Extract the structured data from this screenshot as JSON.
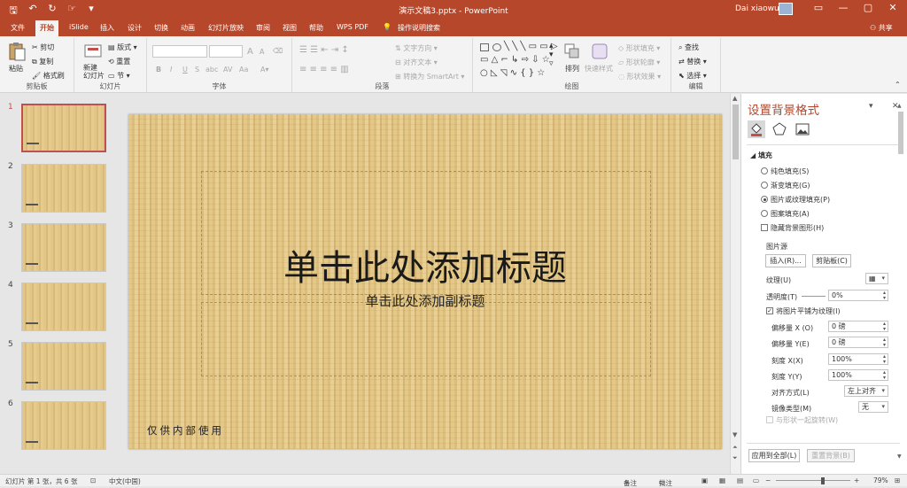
{
  "titlebar": {
    "autosave_icon": "save-icon",
    "undo_icon": "undo-icon",
    "redo_icon": "redo-icon",
    "doc_title": "演示文稿3.pptx  -  PowerPoint",
    "user": "Dai xiaowu",
    "window_controls": [
      "▭",
      "—",
      "▢",
      "✕"
    ]
  },
  "tabs": [
    "文件",
    "开始",
    "iSlide",
    "插入",
    "设计",
    "切换",
    "动画",
    "幻灯片放映",
    "审阅",
    "视图",
    "帮助",
    "WPS PDF"
  ],
  "active_tab": "开始",
  "tell_me": "操作说明搜索",
  "share": "共享",
  "ribbon": {
    "clipboard": {
      "label": "剪贴板",
      "paste": "粘贴",
      "cut": "剪切",
      "copy": "复制",
      "format_painter": "格式刷"
    },
    "slides": {
      "label": "幻灯片",
      "new_slide": "新建\n幻灯片",
      "layout": "版式",
      "reset": "重置",
      "section": "节"
    },
    "font": {
      "label": "字体",
      "bold": "B",
      "italic": "I",
      "underline": "U",
      "strike": "S",
      "shadow": "abc",
      "spacing": "AV",
      "case": "Aa",
      "grow": "A",
      "shrink": "A"
    },
    "paragraph": {
      "label": "段落",
      "text_direction": "文字方向",
      "align_text": "对齐文本",
      "smartart": "转换为 SmartArt"
    },
    "drawing": {
      "label": "绘图",
      "arrange": "排列",
      "quick_styles": "快速样式",
      "shape_fill": "形状填充",
      "shape_outline": "形状轮廓",
      "shape_effects": "形状效果"
    },
    "editing": {
      "label": "编辑",
      "find": "查找",
      "replace": "替换",
      "select": "选择"
    }
  },
  "slides": [
    {
      "n": "1"
    },
    {
      "n": "2"
    },
    {
      "n": "3"
    },
    {
      "n": "4"
    },
    {
      "n": "5"
    },
    {
      "n": "6"
    }
  ],
  "slide": {
    "title": "单击此处添加标题",
    "subtitle": "单击此处添加副标题",
    "footer": "仅供内部使用"
  },
  "pane": {
    "title": "设置背景格式",
    "section_fill": "填充",
    "options": [
      "纯色填充(S)",
      "渐变填充(G)",
      "图片或纹理填充(P)",
      "图案填充(A)"
    ],
    "selected_option": 2,
    "hide_bg": "隐藏背景图形(H)",
    "picture_source": "图片源",
    "insert_btn": "插入(R)...",
    "clipboard_btn": "剪贴板(C)",
    "texture": "纹理(U)",
    "transparency": "透明度(T)",
    "transparency_val": "0%",
    "tile": "将图片平铺为纹理(I)",
    "offset_x": "偏移量 X (O)",
    "offset_x_val": "0 磅",
    "offset_y": "偏移量 Y(E)",
    "offset_y_val": "0 磅",
    "scale_x": "刻度 X(X)",
    "scale_x_val": "100%",
    "scale_y": "刻度 Y(Y)",
    "scale_y_val": "100%",
    "alignment": "对齐方式(L)",
    "alignment_val": "左上对齐",
    "mirror": "镜像类型(M)",
    "mirror_val": "无",
    "rotate_with": "与形状一起旋转(W)",
    "apply_all": "应用到全部(L)",
    "reset_bg": "重置背景(B)"
  },
  "status": {
    "slide_info": "幻灯片 第 1 张，共 6 张",
    "language": "中文(中国)",
    "notes": "备注",
    "comments": "批注",
    "zoom": "79%"
  },
  "colors": {
    "accent": "#b7472a",
    "title_color": "#b7472a"
  }
}
